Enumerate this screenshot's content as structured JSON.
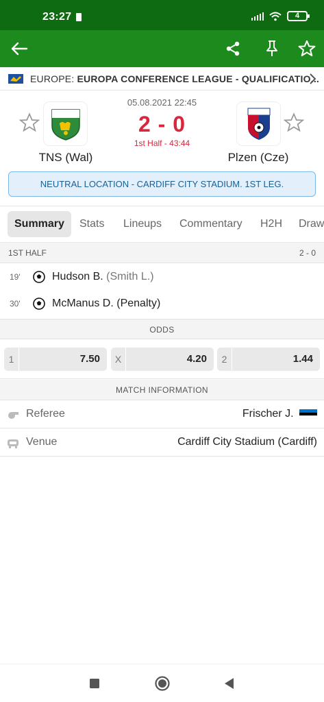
{
  "status_bar": {
    "time": "23:27",
    "battery": "4"
  },
  "app_bar": {
    "back_icon": "arrow-left-icon",
    "share_icon": "share-icon",
    "pin_icon": "pin-icon",
    "star_icon": "star-icon"
  },
  "league": {
    "country": "EUROPE:",
    "name": "EUROPA CONFERENCE LEAGUE - QUALIFICATIO..."
  },
  "match": {
    "date": "05.08.2021 22:45",
    "score": "2 - 0",
    "status": "1st Half - 43:44",
    "home": {
      "name": "TNS (Wal)",
      "logo_text": "The New Saints"
    },
    "away": {
      "name": "Plzen (Cze)",
      "logo_text": "PLZEN VIKTORIA"
    },
    "info": "NEUTRAL LOCATION - CARDIFF CITY STADIUM. 1ST LEG."
  },
  "tabs": [
    "Summary",
    "Stats",
    "Lineups",
    "Commentary",
    "H2H",
    "Draw"
  ],
  "first_half": {
    "label": "1ST HALF",
    "score": "2 - 0",
    "events": [
      {
        "minute": "19'",
        "player": "Hudson B.",
        "detail": "(Smith L.)"
      },
      {
        "minute": "30'",
        "player": "McManus D.",
        "detail": "(Penalty)"
      }
    ]
  },
  "odds": {
    "label": "ODDS",
    "items": [
      {
        "label": "1",
        "value": "7.50"
      },
      {
        "label": "X",
        "value": "4.20"
      },
      {
        "label": "2",
        "value": "1.44"
      }
    ]
  },
  "match_info": {
    "label": "MATCH INFORMATION",
    "referee_label": "Referee",
    "referee_value": "Frischer J.",
    "venue_label": "Venue",
    "venue_value": "Cardiff City Stadium (Cardiff)"
  },
  "colors": {
    "header": "#1d8a1d",
    "status_bar": "#0f6b12",
    "score": "#d7263d",
    "info_box": "#e3f0fb"
  }
}
